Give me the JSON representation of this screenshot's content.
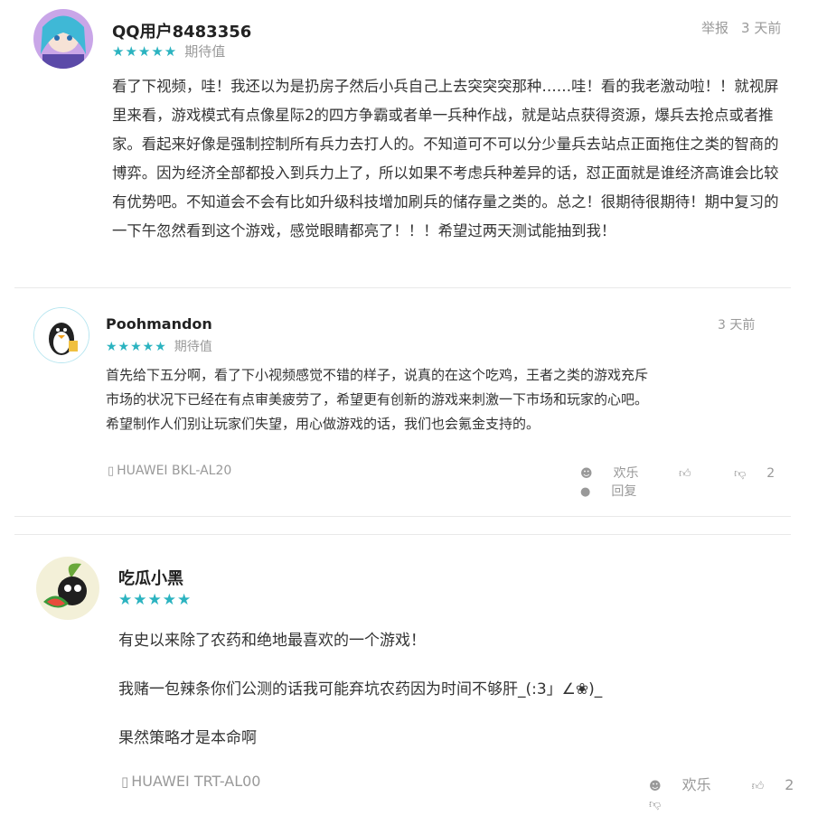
{
  "reviews": [
    {
      "username": "QQ用户8483356",
      "stars": "★★★★★",
      "rating_label": "期待值",
      "report_label": "举报",
      "time": "3 天前",
      "body": "看了下视频，哇！我还以为是扔房子然后小兵自己上去突突突那种……哇！看的我老激动啦！！就视屏里来看，游戏模式有点像星际2的四方争霸或者单一兵种作战，就是站点获得资源，爆兵去抢点或者推家。看起来好像是强制控制所有兵力去打人的。不知道可不可以分少量兵去站点正面拖住之类的智商的博弈。因为经济全部都投入到兵力上了，所以如果不考虑兵种差异的话，怼正面就是谁经济高谁会比较有优势吧。不知道会不会有比如升级科技增加刷兵的储存量之类的。总之！很期待很期待！期中复习的一下午忽然看到这个游戏，感觉眼睛都亮了！！！希望过两天测试能抽到我！"
    },
    {
      "username": "Poohmandon",
      "stars": "★★★★★",
      "rating_label": "期待值",
      "time": "3 天前",
      "body_lines": [
        "首先给下五分啊，看了下小视频感觉不错的样子，说真的在这个吃鸡，王者之类的游戏充斥",
        "市场的状况下已经在有点审美疲劳了，希望更有创新的游戏来刺激一下市场和玩家的心吧。",
        "希望制作人们别让玩家们失望，用心做游戏的话，我们也会氪金支持的。"
      ],
      "device": "HUAWEI BKL-AL20",
      "fun_label": "欢乐",
      "dislike_count": "2",
      "reply_label": "回复"
    },
    {
      "username": "吃瓜小黑",
      "stars": "★★★★★",
      "paragraphs": [
        "有史以来除了农药和绝地最喜欢的一个游戏！",
        "我赌一包辣条你们公测的话我可能弃坑农药因为时间不够肝_(:3」∠❀)_",
        "果然策略才是本命啊"
      ],
      "device": "HUAWEI TRT-AL00",
      "fun_label": "欢乐",
      "like_count": "2"
    }
  ],
  "colors": {
    "star": "#2bb3c0",
    "meta": "#9a9a9a",
    "text": "#333333"
  }
}
